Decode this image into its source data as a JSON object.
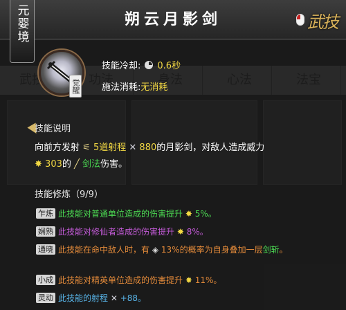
{
  "realm": "元婴境",
  "skill_title": "朔云月影剑",
  "category_label": "武技",
  "awaken_badge": "觉醒",
  "stats": {
    "cooldown_label": "技能冷却:",
    "cooldown_value": "0.6秒",
    "cost_label": "施法消耗:",
    "cost_value": "无消耗"
  },
  "description": {
    "heading": "技能说明",
    "p1": "向前方发射",
    "count": "5道射程",
    "range": "880",
    "p2": "的月影剑，对敌人造成威力",
    "power": "303",
    "p3": "的",
    "element": "剑法",
    "p4": "伤害。"
  },
  "modifiers": {
    "heading": "技能修炼（9/9）",
    "items": [
      {
        "tag": "乍炼",
        "color": "green",
        "text": "此技能对普通单位造成的伤害提升",
        "value": "5%。"
      },
      {
        "tag": "娴熟",
        "color": "purple",
        "text": "此技能对修仙者造成的伤害提升",
        "value": "8%。"
      },
      {
        "tag": "通晓",
        "color": "orange",
        "text": "此技能在命中敌人时，有",
        "value": "13%",
        "text2": "的概率为自身叠加一层",
        "value2": "剑斩",
        "text3": "。"
      },
      {
        "tag": "小成",
        "color": "orange",
        "text": "此技能对精英单位造成的伤害提升",
        "value": "11%。"
      },
      {
        "tag": "灵动",
        "color": "blue",
        "text": "此技能的射程",
        "value": "+88。"
      }
    ]
  },
  "bg_tabs": [
    "武技",
    "功法",
    "身法",
    "心法",
    "法宝"
  ]
}
